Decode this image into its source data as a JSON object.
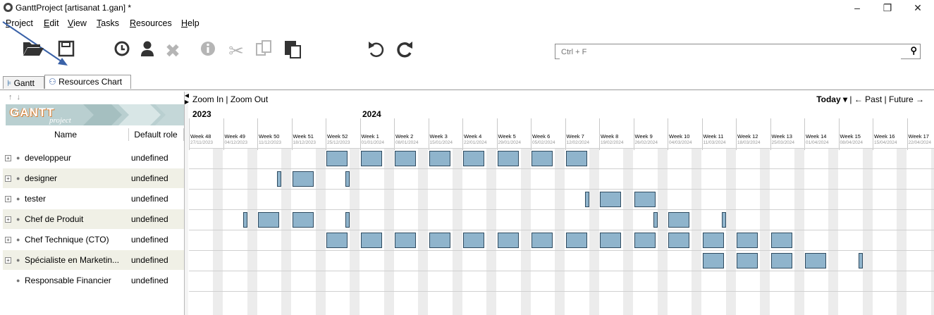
{
  "window": {
    "title": "GanttProject [artisanat 1.gan] *",
    "minimize": "–",
    "maximize": "❐",
    "close": "✕"
  },
  "menu": [
    {
      "mnemonic": "P",
      "rest": "roject"
    },
    {
      "mnemonic": "E",
      "rest": "dit"
    },
    {
      "mnemonic": "V",
      "rest": "iew"
    },
    {
      "mnemonic": "T",
      "rest": "asks"
    },
    {
      "mnemonic": "R",
      "rest": "esources"
    },
    {
      "mnemonic": "H",
      "rest": "elp"
    }
  ],
  "toolbar": {
    "icons": [
      "open-folder-icon",
      "save-icon",
      "clock-icon",
      "person-icon",
      "delete-icon",
      "info-icon",
      "cut-icon",
      "copy-icon",
      "paste-icon",
      "undo-icon",
      "redo-icon"
    ],
    "search_placeholder": "Ctrl + F"
  },
  "tabs": [
    {
      "label": "Gantt",
      "active": false
    },
    {
      "label": "Resources Chart",
      "active": true
    }
  ],
  "logo": {
    "main": "GANTT",
    "sub": "project"
  },
  "table": {
    "columns": [
      "Name",
      "Default role"
    ],
    "rows": [
      {
        "name": "developpeur",
        "role": "undefined",
        "expandable": true
      },
      {
        "name": "designer",
        "role": "undefined",
        "expandable": true
      },
      {
        "name": "tester",
        "role": "undefined",
        "expandable": true
      },
      {
        "name": "Chef de Produit",
        "role": "undefined",
        "expandable": true
      },
      {
        "name": "Chef Technique (CTO)",
        "role": "undefined",
        "expandable": true
      },
      {
        "name": "Spécialiste en Marketin...",
        "role": "undefined",
        "expandable": true
      },
      {
        "name": "Responsable Financier",
        "role": "undefined",
        "expandable": false
      }
    ]
  },
  "chart_header": {
    "zoom_in": "Zoom In",
    "zoom_sep": "|",
    "zoom_out": "Zoom Out",
    "today": "Today",
    "past": "← Past",
    "future": "Future →",
    "years": [
      "2023",
      "2024"
    ]
  },
  "weeks": [
    {
      "name": "Week 48",
      "date": "27/11/2023"
    },
    {
      "name": "Week 49",
      "date": "04/12/2023"
    },
    {
      "name": "Week 50",
      "date": "11/12/2023"
    },
    {
      "name": "Week 51",
      "date": "18/12/2023"
    },
    {
      "name": "Week 52",
      "date": "25/12/2023"
    },
    {
      "name": "Week 1",
      "date": "01/01/2024"
    },
    {
      "name": "Week 2",
      "date": "08/01/2024"
    },
    {
      "name": "Week 3",
      "date": "15/01/2024"
    },
    {
      "name": "Week 4",
      "date": "22/01/2024"
    },
    {
      "name": "Week 5",
      "date": "29/01/2024"
    },
    {
      "name": "Week 6",
      "date": "05/02/2024"
    },
    {
      "name": "Week 7",
      "date": "12/02/2024"
    },
    {
      "name": "Week 8",
      "date": "19/02/2024"
    },
    {
      "name": "Week 9",
      "date": "26/02/2024"
    },
    {
      "name": "Week 10",
      "date": "04/03/2024"
    },
    {
      "name": "Week 11",
      "date": "11/03/2024"
    },
    {
      "name": "Week 12",
      "date": "18/03/2024"
    },
    {
      "name": "Week 13",
      "date": "25/03/2024"
    },
    {
      "name": "Week 14",
      "date": "01/04/2024"
    },
    {
      "name": "Week 15",
      "date": "08/04/2024"
    },
    {
      "name": "Week 16",
      "date": "15/04/2024"
    },
    {
      "name": "Week 17",
      "date": "22/04/2024"
    }
  ],
  "load": [
    [
      [
        4,
        5
      ],
      [
        5,
        5
      ],
      [
        6,
        5
      ],
      [
        7,
        5
      ],
      [
        8,
        5
      ],
      [
        9,
        5
      ],
      [
        10,
        5
      ],
      [
        11,
        5
      ]
    ],
    [
      [
        2,
        1
      ],
      [
        3,
        5
      ],
      [
        4,
        1
      ]
    ],
    [
      [
        11,
        1
      ],
      [
        12,
        5
      ],
      [
        13,
        5
      ]
    ],
    [
      [
        1,
        1
      ],
      [
        2,
        5
      ],
      [
        3,
        5
      ],
      [
        4,
        1
      ],
      [
        13,
        1
      ],
      [
        14,
        5
      ],
      [
        15,
        1
      ]
    ],
    [
      [
        4,
        5
      ],
      [
        5,
        5
      ],
      [
        6,
        5
      ],
      [
        7,
        5
      ],
      [
        8,
        5
      ],
      [
        9,
        5
      ],
      [
        10,
        5
      ],
      [
        11,
        5
      ],
      [
        12,
        5
      ],
      [
        13,
        5
      ],
      [
        14,
        5
      ],
      [
        15,
        5
      ],
      [
        16,
        5
      ],
      [
        17,
        5
      ]
    ],
    [
      [
        15,
        5
      ],
      [
        16,
        5
      ],
      [
        17,
        5
      ],
      [
        18,
        5
      ],
      [
        19,
        1
      ]
    ],
    []
  ],
  "colors": {
    "bar_fill": "#8fb4cc",
    "bar_border": "#2f4b60",
    "weekend": "#ececec"
  }
}
